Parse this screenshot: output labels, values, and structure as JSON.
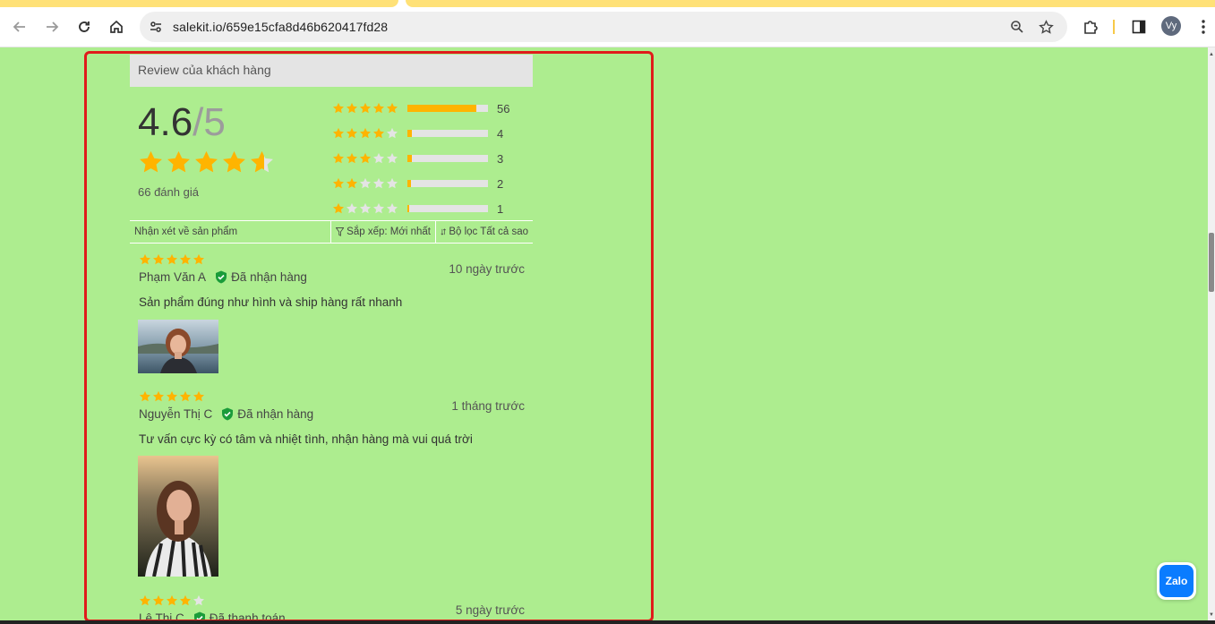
{
  "browser": {
    "url": "salekit.io/659e15cfa8d46b620417fd28",
    "profile_initials": "Vy",
    "accent": "#ffe177"
  },
  "review_panel": {
    "header": "Review của khách hàng",
    "average": "4.6",
    "out_of": "/5",
    "average_value": 4.6,
    "total_label": "66 đánh giá",
    "distribution": [
      {
        "stars": 5,
        "count": "56",
        "fraction": 0.85
      },
      {
        "stars": 4,
        "count": "4",
        "fraction": 0.06
      },
      {
        "stars": 3,
        "count": "3",
        "fraction": 0.05
      },
      {
        "stars": 2,
        "count": "2",
        "fraction": 0.04
      },
      {
        "stars": 1,
        "count": "1",
        "fraction": 0.02
      }
    ],
    "filters": {
      "comments": "Nhận xét về sản phẩm",
      "sort": "Sắp xếp: Mới nhất",
      "filter": "Bộ lọc Tất cả sao"
    },
    "reviews": [
      {
        "stars": 5,
        "name": "Phạm Văn A",
        "badge": "Đã nhận hàng",
        "time": "10 ngày trước",
        "text": "Sản phẩm đúng như hình và ship hàng rất nhanh"
      },
      {
        "stars": 5,
        "name": "Nguyễn Thị C",
        "badge": "Đã nhận hàng",
        "time": "1 tháng trước",
        "text": "Tư vấn cực kỳ có tâm và nhiệt tình, nhận hàng mà vui quá trời"
      },
      {
        "stars": 4,
        "name": "Lê Thị C",
        "badge": "Đã thanh toán",
        "time": "5 ngày trước",
        "text": ""
      }
    ],
    "star_color": "#ffb400",
    "empty_star_color": "#e4e4e4",
    "verified_color": "#1a9c3a"
  },
  "zalo": {
    "label": "Zalo"
  }
}
